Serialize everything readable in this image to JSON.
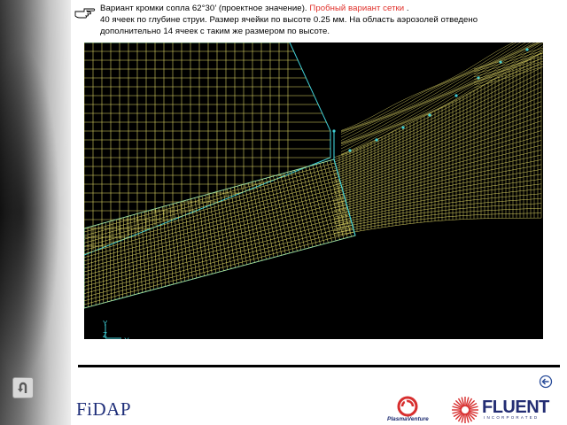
{
  "caption": {
    "line1_prefix": "Вариант кромки сопла 62°30’ (проектное значение). ",
    "line1_red": "Пробный вариант сетки",
    "line1_suffix": " .",
    "line2": "40 ячеек по глубине струи. Размер ячейки по высоте 0.25 мм.  На область аэрозолей отведено",
    "line3": "дополнительно 14 ячеек с таким же размером по высоте."
  },
  "axes": {
    "y_label": "Y",
    "z_label": "Z",
    "x_label": "X"
  },
  "logos": {
    "fidap": "FiDAP",
    "plasma": "PlasmaVenture",
    "fluent": "FLUENT",
    "fluent_sub": "INCORPORATED"
  },
  "colors": {
    "mesh_yellow": "#e8e06a",
    "mesh_cyan": "#3fd0d8",
    "panel_bg": "#000000",
    "caption_red": "#e0302a"
  },
  "icons": {
    "pointer": "pointing-hand-icon",
    "sidebar_back": "u-turn-arrow-icon",
    "nav_back": "back-arrow-circle-icon"
  }
}
